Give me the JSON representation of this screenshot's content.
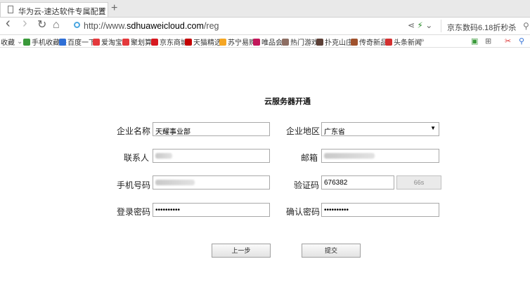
{
  "tab": {
    "title": "华为云-速达软件专属配置",
    "close": "×",
    "new": "+"
  },
  "nav": {
    "back": "‹",
    "forward": "›",
    "reload": "↻",
    "home": "⌂",
    "url_prefix": "http://www.",
    "url_host": "sdhuaweicloud.com",
    "url_path": "/reg",
    "search_text": "京东数码6.18折秒杀"
  },
  "bookmarks": {
    "favorites_label": "收藏",
    "items": [
      {
        "label": "手机收藏夹",
        "color": "#3a9a3a"
      },
      {
        "label": "百度一下",
        "color": "#2f6fd6"
      },
      {
        "label": "爱淘宝",
        "color": "#e4393c"
      },
      {
        "label": "聚划算",
        "color": "#e4393c"
      },
      {
        "label": "京东商城",
        "color": "#d71920"
      },
      {
        "label": "天猫精选",
        "color": "#c40000"
      },
      {
        "label": "苏宁易购",
        "color": "#f5a623"
      },
      {
        "label": "唯品会",
        "color": "#c2185b"
      },
      {
        "label": "热门游戏",
        "color": "#8d6e63"
      },
      {
        "label": "扑克山庄",
        "color": "#5d4037"
      },
      {
        "label": "传奇新品",
        "color": "#a0522d"
      },
      {
        "label": "头条新闻",
        "color": "#d32f2f"
      }
    ],
    "more": "»"
  },
  "form": {
    "title": "云服务器开通",
    "company_name_label": "企业名称",
    "company_name_value": "天耀事业部",
    "region_label": "企业地区",
    "region_value": "广东省",
    "contact_label": "联系人",
    "email_label": "邮箱",
    "phone_label": "手机号码",
    "code_label": "验证码",
    "code_value": "676382",
    "code_button": "66s",
    "password_label": "登录密码",
    "password_value": "••••••••••",
    "confirm_label": "确认密码",
    "confirm_value": "••••••••••",
    "prev_button": "上一步",
    "submit_button": "提交"
  }
}
